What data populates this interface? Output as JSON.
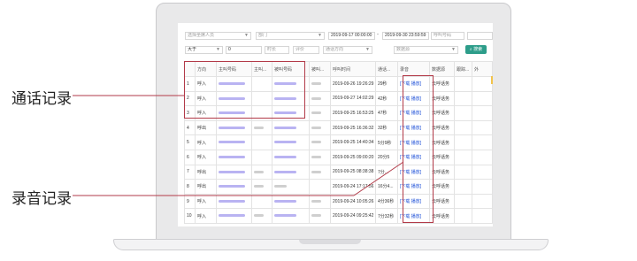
{
  "callouts": {
    "call_records": "通话记录",
    "recording_records": "录音记录"
  },
  "filters": {
    "row1": [
      "选择坐席人员",
      "部门",
      "2019-09-17 00:00:00",
      "-",
      "2019-09-30 23:59:59",
      "呼叫号码",
      ""
    ],
    "row2": [
      "大于",
      "0",
      "时长",
      "评价",
      "通话方向",
      "数据源"
    ],
    "search_button": "搜索"
  },
  "table": {
    "headers": [
      "",
      "方向",
      "主叫号码",
      "主叫...",
      "被叫号码",
      "被叫...",
      "呼叫时间",
      "通话...",
      "录音",
      "数据源",
      "跟踪...",
      "外"
    ],
    "rows": [
      [
        "1",
        "呼入",
        "2019-09-26 19:26:29",
        "29秒"
      ],
      [
        "2",
        "呼入",
        "2019-09-27 14:02:29",
        "42秒"
      ],
      [
        "3",
        "呼入",
        "2019-09-25 16:53:25",
        "47秒"
      ],
      [
        "4",
        "呼出",
        "2019-09-25 16:36:32",
        "32秒"
      ],
      [
        "5",
        "呼入",
        "2019-09-25 14:40:34",
        "5分9秒"
      ],
      [
        "6",
        "呼入",
        "2019-09-25 09:00:20",
        "20分5"
      ],
      [
        "7",
        "呼出",
        "2019-09-25 08:38:38",
        "7分..."
      ],
      [
        "8",
        "呼出",
        "2019-09-24 17:17:56",
        "16分4..."
      ],
      [
        "9",
        "呼入",
        "2019-09-24 10:05:26",
        "4分36秒"
      ],
      [
        "10",
        "呼入",
        "2019-09-24 09:25:42",
        "7分32秒"
      ]
    ],
    "recording_label": "[下载 播放]",
    "source_label": "云呼话务"
  },
  "colors": {
    "highlight": "#b23a48",
    "accent": "#2d9d8a",
    "link": "#1e50d8"
  }
}
